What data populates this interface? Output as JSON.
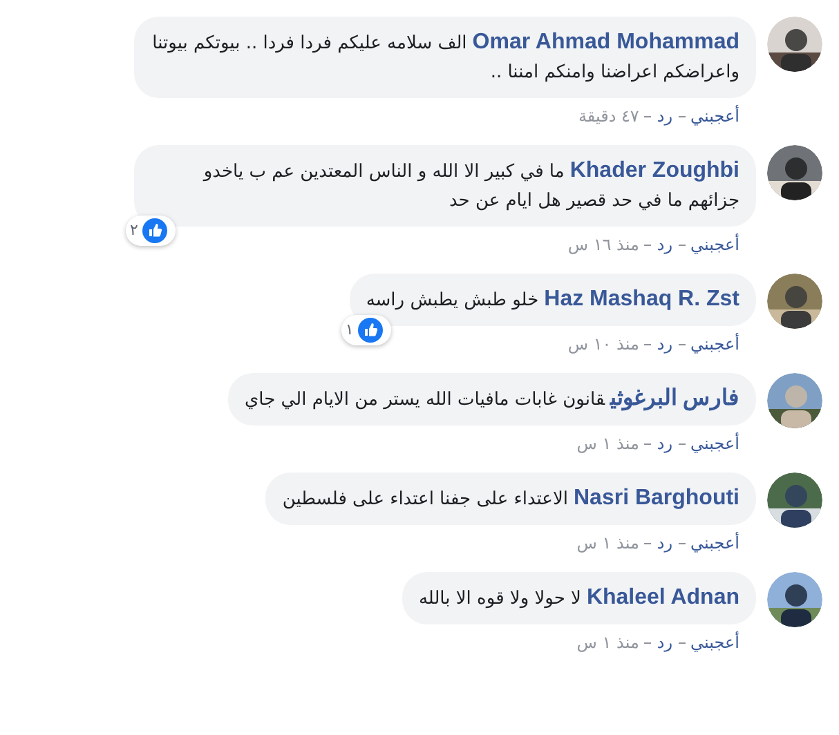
{
  "comments": [
    {
      "author": "Omar Ahmad Mohammad",
      "text": "الف سلامه عليكم فردا فردا .. بيوتكم بيوتنا واعراضكم اعراضنا وامنكم امننا ..",
      "like": "أعجبني",
      "reply": "رد",
      "time": "٤٧ دقيقة"
    },
    {
      "author": "Khader Zoughbi",
      "text": "ما في كبير الا الله و الناس المعتدين عم ب ياخدو جزائهم ما في حد قصير هل ايام عن حد",
      "like": "أعجبني",
      "reply": "رد",
      "time": "منذ ١٦ س",
      "reactions": "٢"
    },
    {
      "author": "Haz Mashaq R. Zst",
      "text": "خلو طبش يطبش راسه",
      "like": "أعجبني",
      "reply": "رد",
      "time": "منذ ١٠ س",
      "reactions": "١"
    },
    {
      "author": "فارس البرغوثي",
      "text": "قانون غابات مافيات الله يستر من الايام الي جاي",
      "like": "أعجبني",
      "reply": "رد",
      "time": "منذ ١ س"
    },
    {
      "author": "Nasri Barghouti",
      "text": "الاعتداء على جفنا اعتداء على فلسطين",
      "like": "أعجبني",
      "reply": "رد",
      "time": "منذ ١ س"
    },
    {
      "author": "Khaleel Adnan",
      "text": "لا حولا ولا قوه الا بالله",
      "like": "أعجبني",
      "reply": "رد",
      "time": "منذ ١ س"
    }
  ]
}
